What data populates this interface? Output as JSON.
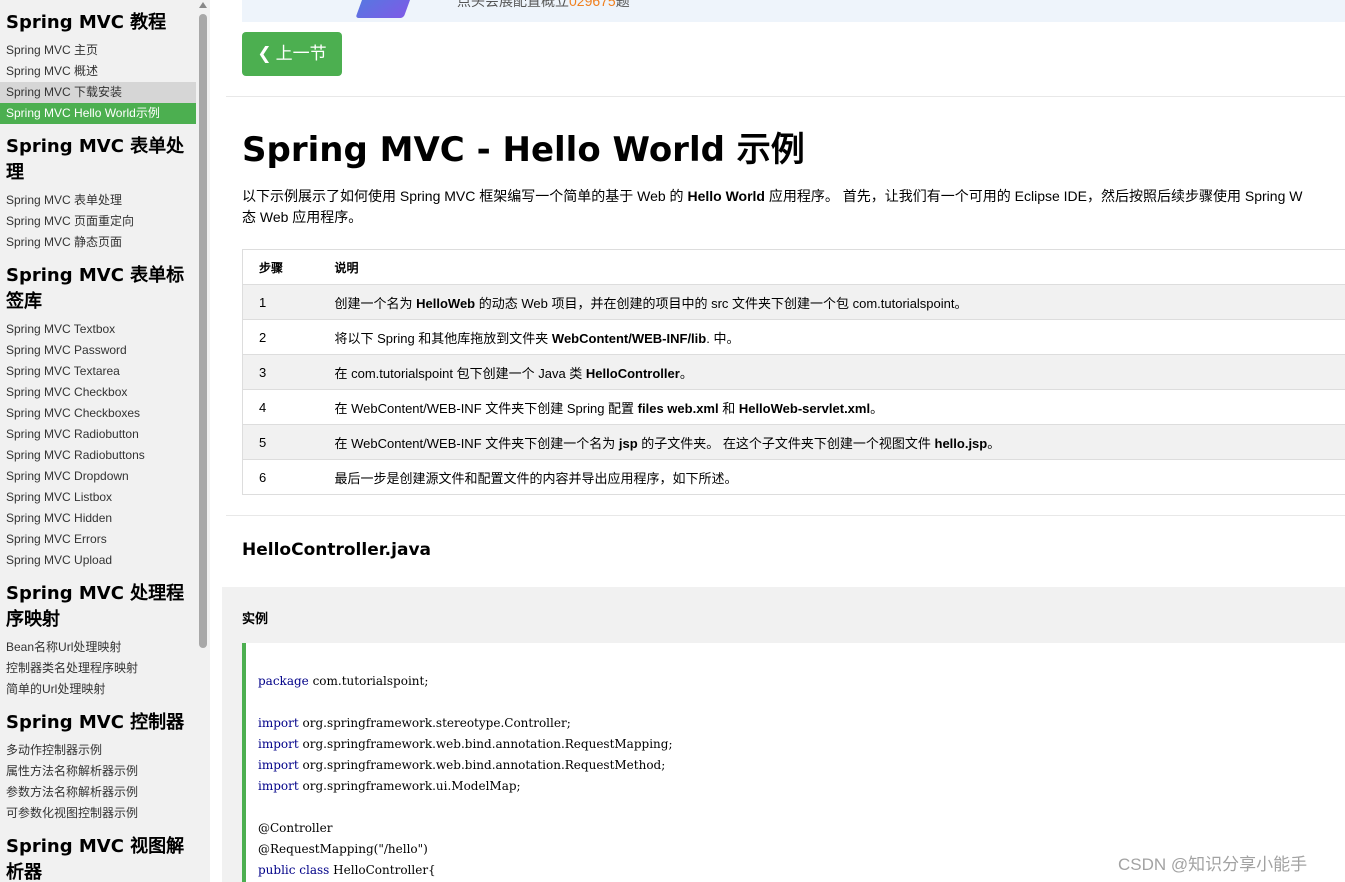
{
  "sidebar": {
    "groups": [
      {
        "heading": "Spring MVC 教程",
        "items": [
          "Spring MVC 主页",
          "Spring MVC 概述",
          "Spring MVC 下载安装",
          "Spring MVC Hello World示例"
        ]
      },
      {
        "heading": "Spring MVC 表单处理",
        "items": [
          "Spring MVC 表单处理",
          "Spring MVC 页面重定向",
          "Spring MVC 静态页面"
        ]
      },
      {
        "heading": "Spring MVC 表单标签库",
        "items": [
          "Spring MVC Textbox",
          "Spring MVC Password",
          "Spring MVC Textarea",
          "Spring MVC Checkbox",
          "Spring MVC Checkboxes",
          "Spring MVC Radiobutton",
          "Spring MVC Radiobuttons",
          "Spring MVC Dropdown",
          "Spring MVC Listbox",
          "Spring MVC Hidden",
          "Spring MVC Errors",
          "Spring MVC Upload"
        ]
      },
      {
        "heading": "Spring MVC 处理程序映射",
        "items": [
          "Bean名称Url处理映射",
          "控制器类名处理程序映射",
          "简单的Url处理映射"
        ]
      },
      {
        "heading": "Spring MVC 控制器",
        "items": [
          "多动作控制器示例",
          "属性方法名称解析器示例",
          "参数方法名称解析器示例",
          "可参数化视图控制器示例"
        ]
      },
      {
        "heading": "Spring MVC 视图解析器",
        "items": []
      }
    ],
    "hover_item": "Spring MVC 下载安装",
    "active_item": "Spring MVC Hello World示例"
  },
  "banner": {
    "text_prefix": "点头会展配置概立",
    "text_highlight": "029675",
    "text_suffix": "题"
  },
  "nav": {
    "prev_label": "上一节",
    "prev_icon": "chevron-left-icon"
  },
  "page": {
    "title": "Spring MVC - Hello World 示例",
    "intro_1": "以下示例展示了如何使用 Spring MVC 框架编写一个简单的基于 Web 的 ",
    "intro_bold": "Hello World",
    "intro_2": " 应用程序。 首先，让我们有一个可用的 Eclipse IDE，然后按照后续步骤使用 Spring W",
    "intro_3": "态 Web 应用程序。"
  },
  "steps_table": {
    "headers": [
      "步骤",
      "说明"
    ],
    "rows": [
      {
        "step": "1",
        "pre": "创建一个名为 ",
        "b1": "HelloWeb",
        "mid": " 的动态 Web 项目，并在创建的项目中的 src 文件夹下创建一个包 com.tutorialspoint。",
        "b2": "",
        "post": ""
      },
      {
        "step": "2",
        "pre": "将以下 Spring 和其他库拖放到文件夹 ",
        "b1": "WebContent/WEB-INF/lib",
        "mid": ". 中。",
        "b2": "",
        "post": ""
      },
      {
        "step": "3",
        "pre": "在 com.tutorialspoint 包下创建一个 Java 类 ",
        "b1": "HelloController",
        "mid": "。",
        "b2": "",
        "post": ""
      },
      {
        "step": "4",
        "pre": "在 WebContent/WEB-INF 文件夹下创建 Spring 配置 ",
        "b1": "files web.xml",
        "mid": " 和 ",
        "b2": "HelloWeb-servlet.xml",
        "post": "。"
      },
      {
        "step": "5",
        "pre": "在 WebContent/WEB-INF 文件夹下创建一个名为 ",
        "b1": "jsp",
        "mid": " 的子文件夹。 在这个子文件夹下创建一个视图文件 ",
        "b2": "hello.jsp",
        "post": "。"
      },
      {
        "step": "6",
        "pre": "最后一步是创建源文件和配置文件的内容并导出应用程序，如下所述。",
        "b1": "",
        "mid": "",
        "b2": "",
        "post": ""
      }
    ]
  },
  "file_heading": "HelloController.java",
  "example": {
    "label": "实例",
    "code_lines": [
      [
        "package",
        " com.tutorialspoint;"
      ],
      [
        "",
        ""
      ],
      [
        "import",
        " org.springframework.stereotype.Controller;"
      ],
      [
        "import",
        " org.springframework.web.bind.annotation.RequestMapping;"
      ],
      [
        "import",
        " org.springframework.web.bind.annotation.RequestMethod;"
      ],
      [
        "import",
        " org.springframework.ui.ModelMap;"
      ],
      [
        "",
        ""
      ],
      [
        "",
        "@Controller"
      ],
      [
        "",
        "@RequestMapping(\"/hello\")"
      ],
      [
        "public class",
        " HelloController{"
      ]
    ]
  },
  "watermark": "CSDN @知识分享小能手"
}
